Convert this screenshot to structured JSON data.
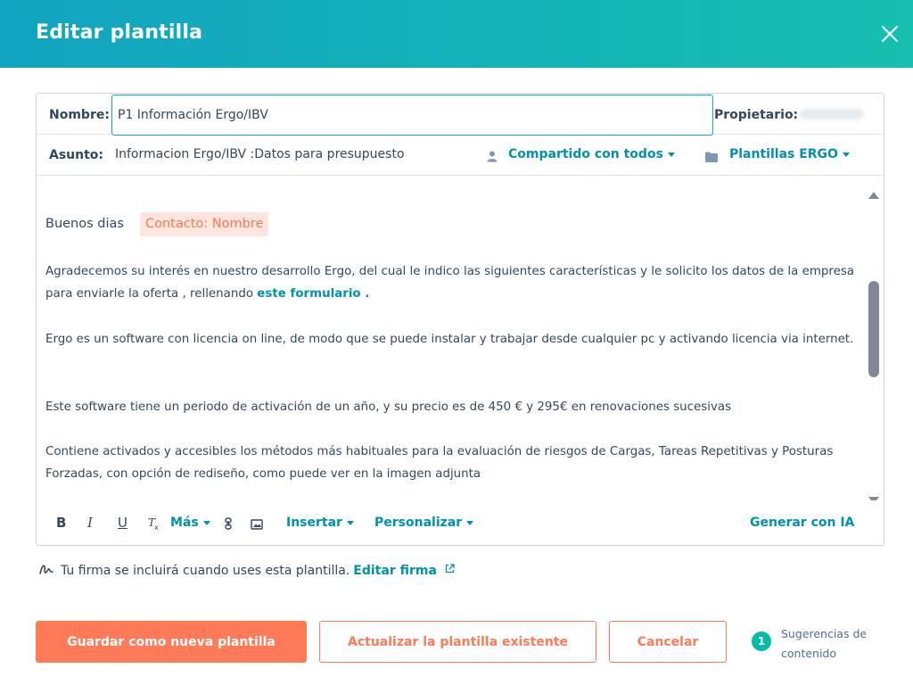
{
  "dialog": {
    "title": "Editar plantilla",
    "close_icon": "close-icon"
  },
  "form": {
    "name_label": "Nombre:",
    "name_value": "P1 Información Ergo/IBV",
    "owner_label": "Propietario:",
    "subject_label": "Asunto:",
    "subject_value": "Informacion Ergo/IBV :Datos para presupuesto",
    "shared_label": "Compartido con todos",
    "folder_label": "Plantillas ERGO"
  },
  "body": {
    "greeting": "Buenos dias",
    "token": "Contacto: Nombre",
    "p1": "Agradecemos su interés en nuestro desarrollo Ergo, del cual le indico las siguientes características y le solicito los datos de la empresa para enviarle la oferta , rellenando ",
    "p1_link": "este formulario .",
    "p2": "Ergo es un software con licencia on line, de modo que se puede instalar y trabajar desde cualquier pc y activando licencia via internet.",
    "p3": "Este software tiene un periodo de activación de un año, y su precio es de 450 € y 295€  en renovaciones sucesivas",
    "p4": "Contiene activados y accesibles los métodos más habituales para la evaluación de riesgos de Cargas, Tareas Repetitivas y Posturas Forzadas, con opción de rediseño, como puede ver en la imagen adjunta"
  },
  "toolbar": {
    "bold": "B",
    "italic": "I",
    "underline": "U",
    "more": "Más",
    "insert": "Insertar",
    "personalize": "Personalizar",
    "ai": "Generar con IA"
  },
  "signature": {
    "text": "Tu firma se incluirá cuando uses esta plantilla.",
    "link": "Editar firma"
  },
  "footer": {
    "save_new": "Guardar como nueva plantilla",
    "update": "Actualizar la plantilla existente",
    "cancel": "Cancelar",
    "suggestions_count": "1",
    "suggestions_label": "Sugerencias de contenido"
  },
  "colors": {
    "header_gradient_start": "#11a5c1",
    "header_gradient_end": "#16bfb0",
    "primary": "#ff7a59",
    "link": "#0091ae",
    "badge": "#00bda5"
  }
}
